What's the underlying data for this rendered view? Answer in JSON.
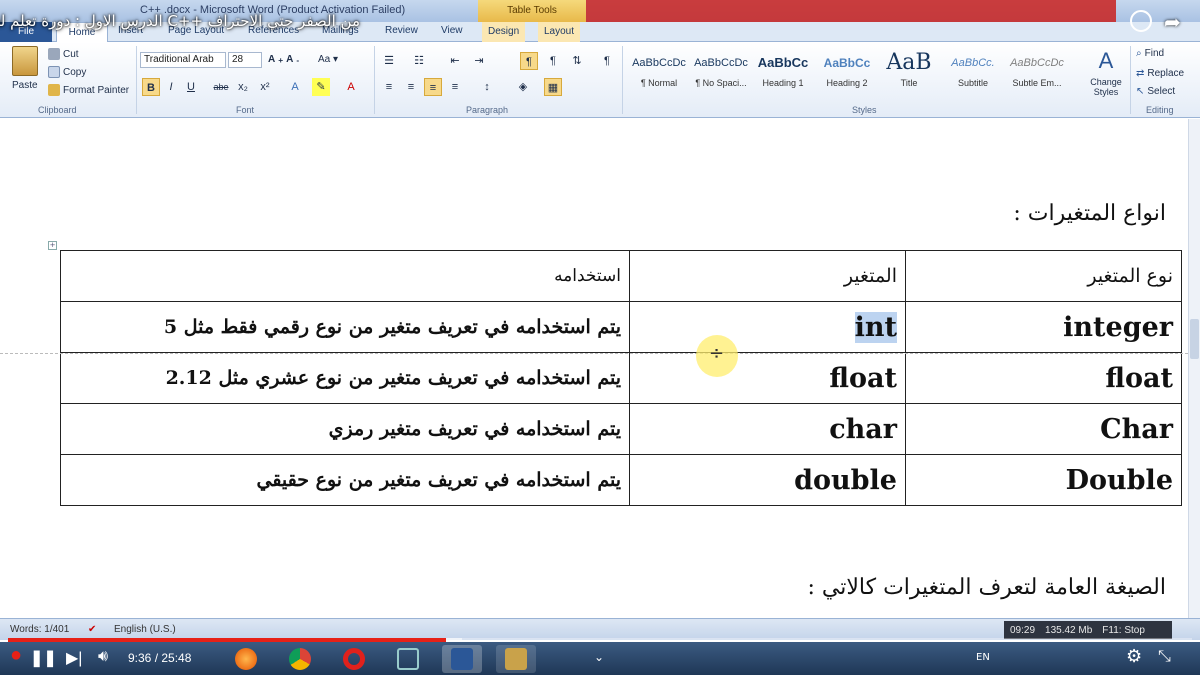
{
  "video": {
    "title": "من الصفر حتي الاحتراف ++C الدرس الاول : دورة تعلم لغة",
    "current_time": "9:36",
    "duration": "25:48",
    "time_separator": " / ",
    "progress_fraction": 0.37
  },
  "word": {
    "window_title": "C++ .docx - Microsoft Word (Product Activation Failed)",
    "table_tools_label": "Table Tools",
    "tabs": [
      "File",
      "Home",
      "Insert",
      "Page Layout",
      "References",
      "Mailings",
      "Review",
      "View",
      "Design",
      "Layout"
    ],
    "clipboard": {
      "paste": "Paste",
      "cut": "Cut",
      "copy": "Copy",
      "format_painter": "Format Painter",
      "label": "Clipboard"
    },
    "font": {
      "name": "Traditional Arab",
      "size": "28",
      "label": "Font",
      "bold": "B",
      "italic": "I",
      "underline": "U",
      "strike": "abe",
      "subscript": "x₂",
      "superscript": "x²"
    },
    "paragraph_label": "Paragraph",
    "styles": [
      {
        "sample": "AaBbCcDc",
        "name": "¶ Normal"
      },
      {
        "sample": "AaBbCcDc",
        "name": "¶ No Spaci..."
      },
      {
        "sample": "AaBbCc",
        "name": "Heading 1"
      },
      {
        "sample": "AaBbCc",
        "name": "Heading 2"
      },
      {
        "sample": "AaB",
        "name": "Title"
      },
      {
        "sample": "AaBbCc.",
        "name": "Subtitle"
      },
      {
        "sample": "AaBbCcDc",
        "name": "Subtle Em..."
      }
    ],
    "styles_label": "Styles",
    "change_styles": "Change Styles",
    "editing": {
      "find": "Find",
      "replace": "Replace",
      "select": "Select",
      "label": "Editing"
    }
  },
  "document": {
    "section_heading": "انواع المتغيرات :",
    "table": {
      "headers": [
        "نوع المتغير",
        "المتغير",
        "استخدامه"
      ],
      "rows": [
        {
          "type": "integer",
          "var": "int",
          "use": "يتم استخدامه في تعريف متغير من نوع رقمي فقط مثل 5"
        },
        {
          "type": "float",
          "var": "float",
          "use": "يتم استخدامه في تعريف متغير من نوع عشري مثل 2.12"
        },
        {
          "type": "Char",
          "var": "char",
          "use": "يتم استخدامه في تعريف متغير رمزي"
        },
        {
          "type": "Double",
          "var": "double",
          "use": "يتم استخدامه في تعريف متغير من نوع حقيقي"
        }
      ]
    },
    "footer_heading": "الصيغة العامة لتعرف المتغيرات كالاتي :"
  },
  "status": {
    "words": "Words: 1/401",
    "language": "English (U.S.)",
    "perf_time": "09:29",
    "memory": "135.42 Mb",
    "f11": "F11: Stop"
  },
  "taskbar": {
    "lang": "EN"
  },
  "colors": {
    "progress": "#e62117",
    "selection": "#bcd3f0",
    "cursor_highlight": "#ffee6e"
  }
}
